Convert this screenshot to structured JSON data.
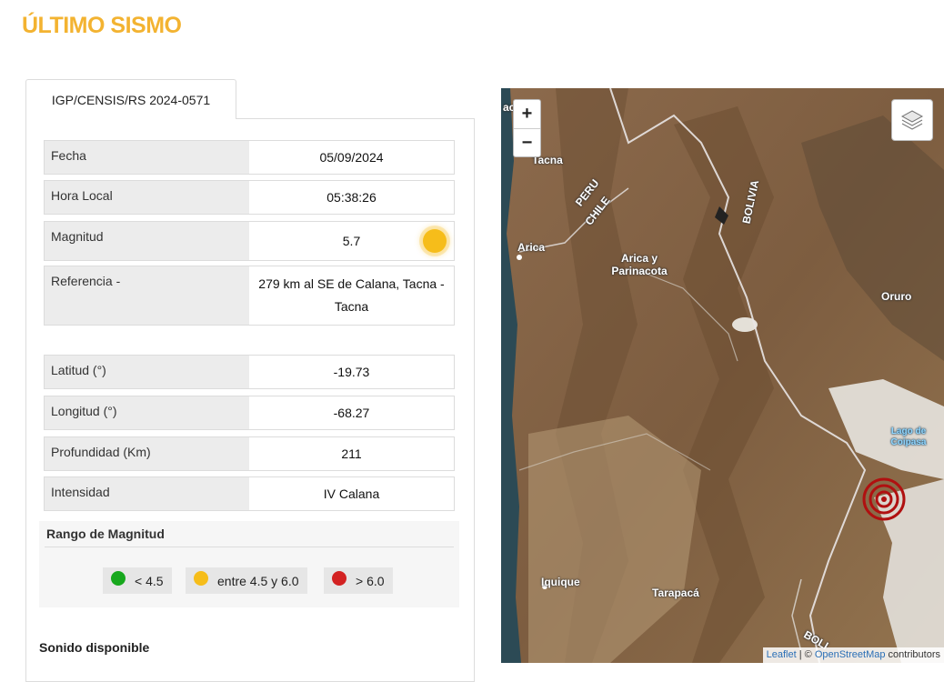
{
  "page_title": "ÚLTIMO SISMO",
  "tab_label": "IGP/CENSIS/RS  2024-0571",
  "fields": {
    "fecha": {
      "label": "Fecha",
      "value": "05/09/2024"
    },
    "hora": {
      "label": "Hora Local",
      "value": "05:38:26"
    },
    "magnitud": {
      "label": "Magnitud",
      "value": "5.7",
      "dot_color": "#f6bd1a"
    },
    "referencia": {
      "label": "Referencia -",
      "value": "279 km al SE de Calana, Tacna - Tacna"
    },
    "latitud": {
      "label": "Latitud (°)",
      "value": "-19.73"
    },
    "longitud": {
      "label": "Longitud (°)",
      "value": "-68.27"
    },
    "profundidad": {
      "label": "Profundidad (Km)",
      "value": "211"
    },
    "intensidad": {
      "label": "Intensidad",
      "value": "IV Calana"
    }
  },
  "range": {
    "title": "Rango de Magnitud",
    "items": [
      {
        "label": "< 4.5",
        "color": "#17a81d"
      },
      {
        "label": "entre 4.5 y 6.0",
        "color": "#f6bd1a"
      },
      {
        "label": "> 6.0",
        "color": "#d32222"
      }
    ]
  },
  "sound_label": "Sonido disponible",
  "map": {
    "zoom_in": "+",
    "zoom_out": "−",
    "attribution_leaflet": "Leaflet",
    "attribution_sep": " | © ",
    "attribution_osm": "OpenStreetMap",
    "attribution_tail": " contributors",
    "labels": {
      "peru": "PERU",
      "chile": "CHILE",
      "bolivia": "BOLIVIA",
      "bolivia_2": "BOLI",
      "arica": "Arica",
      "arica_region": "Arica y Parinacota",
      "oruro": "Oruro",
      "lago": "Lago de Coipasa",
      "iquique": "Iquique",
      "tarapaca": "Tarapacá",
      "tacna": "Tacna",
      "top_left": "ac"
    },
    "colors": {
      "epicenter": "#b01010",
      "terrain": "#8a6a4a",
      "ocean": "#2c4a55"
    }
  }
}
